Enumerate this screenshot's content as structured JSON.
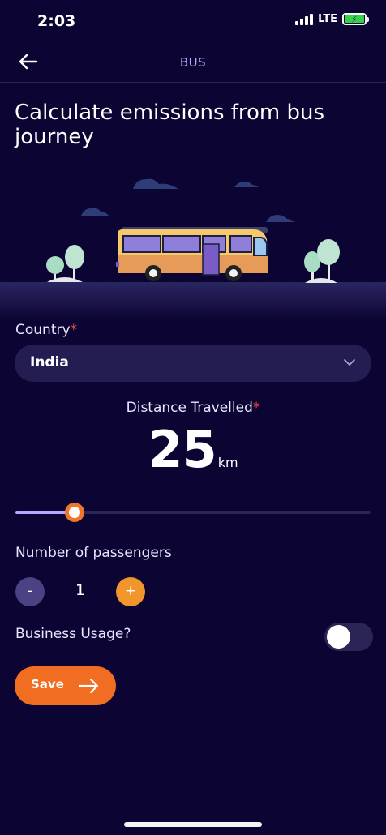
{
  "status_bar": {
    "time": "2:03",
    "network": "LTE",
    "battery_level": 1.0,
    "battery_charging_color": "#38d04a"
  },
  "nav": {
    "title": "BUS",
    "back_icon": "arrow-left-icon"
  },
  "page_title": "Calculate emissions from bus journey",
  "form": {
    "country": {
      "label": "Country",
      "required_mark": "*",
      "value": "India"
    },
    "distance": {
      "label": "Distance Travelled",
      "required_mark": "*",
      "value": "25",
      "unit": "km",
      "slider_fraction": 0.14
    },
    "passengers": {
      "label": "Number of passengers",
      "minus": "-",
      "plus": "+",
      "value": "1"
    },
    "business_usage": {
      "label": "Business Usage?",
      "enabled": false
    },
    "save": {
      "label": "Save",
      "icon": "arrow-right-icon"
    }
  },
  "colors": {
    "background": "#0c0533",
    "accent": "#f06d22",
    "secondary": "#b4a9ff",
    "required": "#ff4545"
  }
}
